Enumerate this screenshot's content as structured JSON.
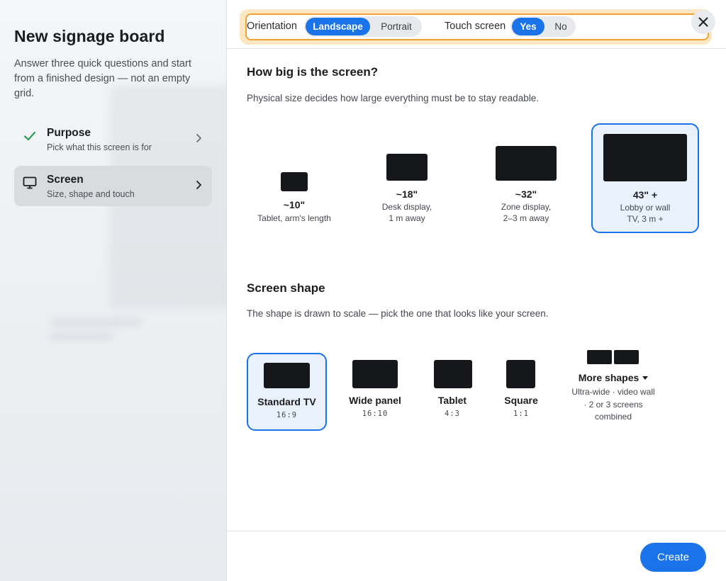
{
  "sidebar": {
    "title": "New signage board",
    "intro": "Answer three quick questions and start from a finished design — not an empty grid.",
    "steps": [
      {
        "title": "Purpose",
        "subtitle": "Pick what this screen is for",
        "icon": "check-icon",
        "status": "done"
      },
      {
        "title": "Screen",
        "subtitle": "Size, shape and touch",
        "icon": "monitor-icon",
        "status": "active"
      }
    ]
  },
  "topbar": {
    "orientation_label": "Orientation",
    "orientation_options": [
      "Landscape",
      "Portrait"
    ],
    "orientation_selected": "Landscape",
    "touch_label": "Touch screen",
    "touch_options": [
      "Yes",
      "No"
    ],
    "touch_selected": "Yes",
    "close_icon": "close-icon",
    "highlight_color": "#f0a235"
  },
  "size_section": {
    "heading": "How big is the screen?",
    "description": "Physical size decides how large everything must be to stay readable.",
    "options": [
      {
        "size": "~10\"",
        "desc1": "Tablet, arm's length",
        "desc2": ""
      },
      {
        "size": "~18\"",
        "desc1": "Desk display,",
        "desc2": "1 m away"
      },
      {
        "size": "~32\"",
        "desc1": "Zone display,",
        "desc2": "2–3 m away"
      },
      {
        "size": "43\" +",
        "desc1": "Lobby or wall",
        "desc2": "TV, 3 m +"
      }
    ],
    "selected": "43\" +"
  },
  "shape_section": {
    "heading": "Screen shape",
    "description": "The shape is drawn to scale — pick the one that looks like your screen.",
    "options": [
      {
        "name": "Standard TV",
        "ratio": "16:9"
      },
      {
        "name": "Wide panel",
        "ratio": "16:10"
      },
      {
        "name": "Tablet",
        "ratio": "4:3"
      },
      {
        "name": "Square",
        "ratio": "1:1"
      }
    ],
    "selected": "Standard TV",
    "more": {
      "label": "More shapes",
      "desc1": "Ultra-wide · video wall",
      "desc2": "· 2 or 3 screens",
      "desc3": "combined"
    }
  },
  "footer": {
    "create_label": "Create"
  },
  "colors": {
    "accent": "#1a73e8",
    "selected_bg": "#e9f1fd",
    "success": "#2e9d5b"
  }
}
